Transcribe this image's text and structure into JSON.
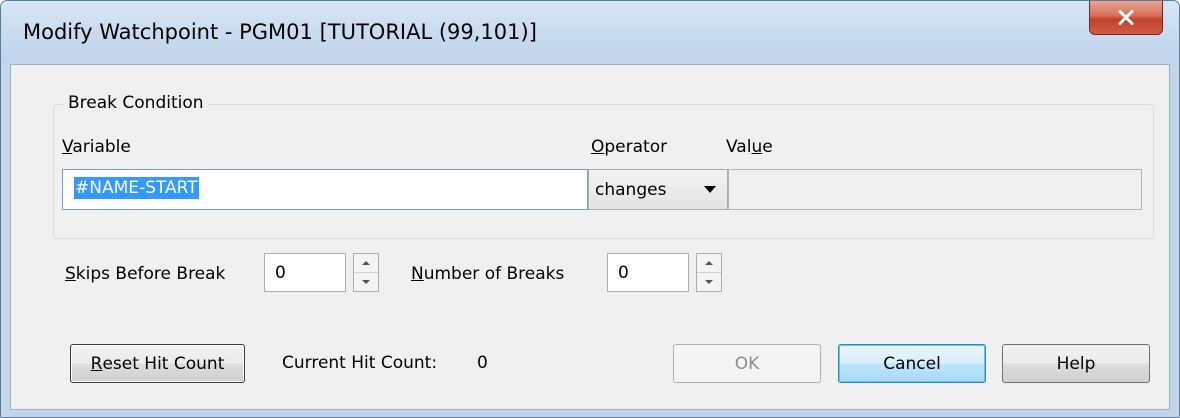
{
  "window": {
    "title": "Modify Watchpoint - PGM01 [TUTORIAL (99,101)]",
    "close_icon": "close-icon"
  },
  "break_condition": {
    "legend": "Break Condition",
    "variable_label_accel": "V",
    "variable_label_rest": "ariable",
    "operator_label_accel": "O",
    "operator_label_rest": "perator",
    "value_label_pre": "Val",
    "value_label_accel": "u",
    "value_label_post": "e",
    "variable_value": "#NAME-START",
    "operator_selected": "changes",
    "value_value": ""
  },
  "counters": {
    "skips_label_accel": "S",
    "skips_label_rest": "kips Before Break",
    "skips_value": "0",
    "breaks_label_accel": "N",
    "breaks_label_rest": "umber of Breaks",
    "breaks_value": "0"
  },
  "footer": {
    "reset_label_accel": "R",
    "reset_label_rest": "eset Hit Count",
    "hit_count_label": "Current Hit Count:",
    "hit_count_value": "0",
    "ok_label": "OK",
    "cancel_label": "Cancel",
    "help_label": "Help"
  },
  "colors": {
    "close_button": "#c0422a",
    "selection": "#3399ff",
    "default_button_border": "#3c7fb1"
  }
}
